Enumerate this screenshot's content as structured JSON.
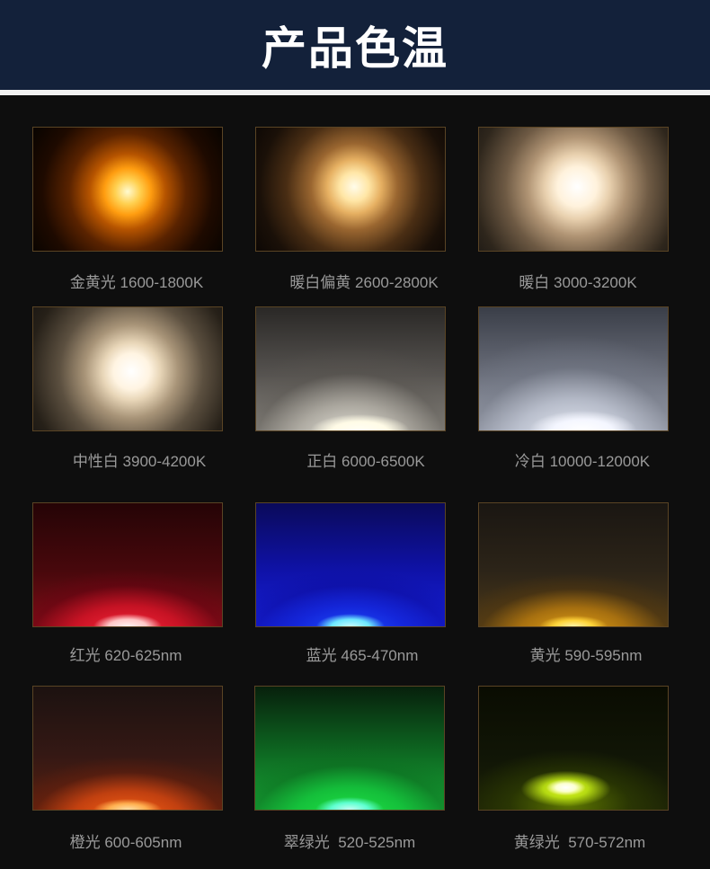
{
  "header": {
    "title": "产品色温"
  },
  "items": [
    {
      "label": "金黄光 1600-1800K"
    },
    {
      "label": "暖白偏黄 2600-2800K"
    },
    {
      "label": "暖白 3000-3200K"
    },
    {
      "label": "中性白 3900-4200K"
    },
    {
      "label": "正白 6000-6500K"
    },
    {
      "label": "冷白 10000-12000K"
    },
    {
      "label": "红光 620-625nm"
    },
    {
      "label": "蓝光 465-470nm"
    },
    {
      "label": "黄光 590-595nm"
    },
    {
      "label": "橙光 600-605nm"
    },
    {
      "label": "翠绿光  520-525nm"
    },
    {
      "label": "黄绿光  570-572nm"
    }
  ]
}
